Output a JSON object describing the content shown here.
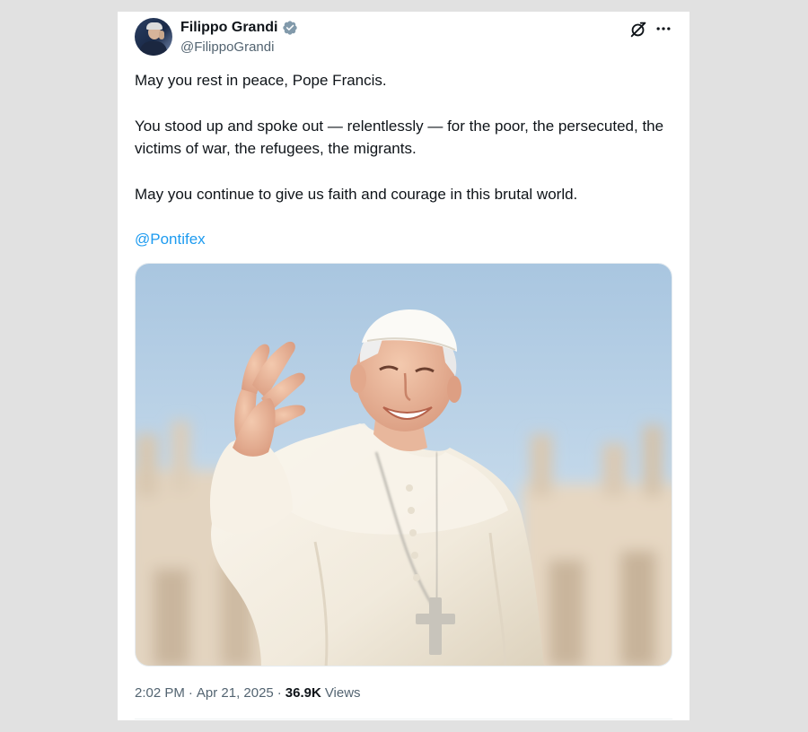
{
  "author": {
    "display_name": "Filippo Grandi",
    "handle": "@FilippoGrandi",
    "verified": true,
    "avatar_icon": "profile-photo"
  },
  "header_actions": {
    "grok_icon": "grok-icon",
    "more_icon": "more-dots-icon"
  },
  "tweet": {
    "paragraphs": [
      "May you rest in peace, Pope Francis.",
      "You stood up and spoke out — relentlessly — for the poor, the persecuted, the victims of war, the refugees, the migrants.",
      "May you continue to give us faith and courage in this brutal world."
    ],
    "mention": "@Pontifex"
  },
  "meta": {
    "time": "2:02 PM",
    "separator": "·",
    "date": "Apr 21, 2025",
    "views_count": "36.9K",
    "views_label": "Views"
  },
  "colors": {
    "link": "#1d9bf0",
    "text_primary": "#0f1419",
    "text_secondary": "#536471",
    "verified": "#829aab",
    "page_background": "#e1e1e1"
  }
}
